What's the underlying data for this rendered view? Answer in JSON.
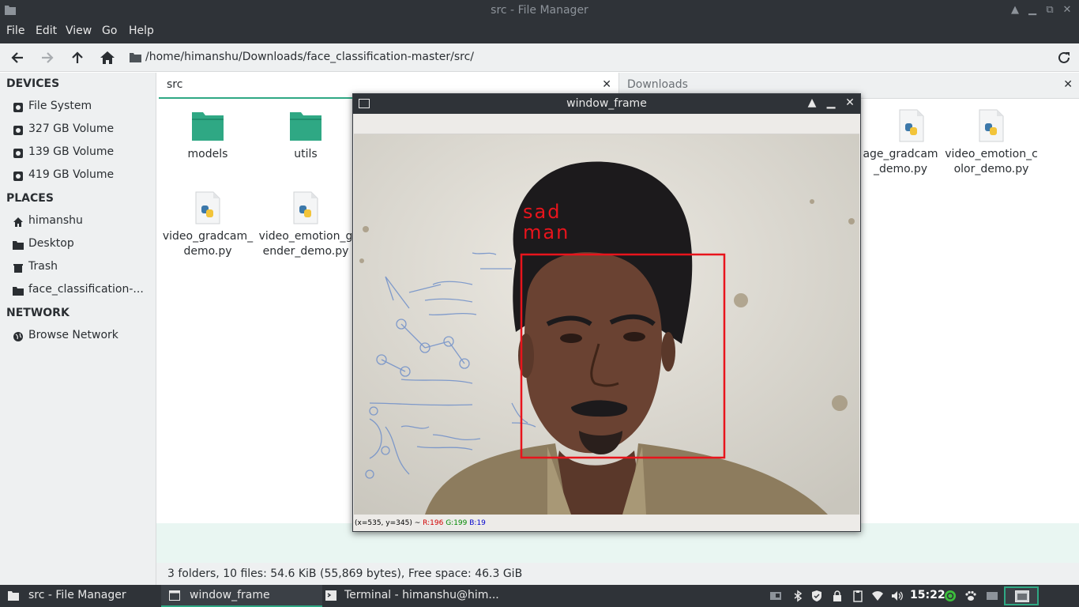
{
  "window": {
    "title": "src - File Manager"
  },
  "menu": [
    "File",
    "Edit",
    "Go",
    "Help"
  ],
  "toolbar": {
    "path": "/home/himanshu/Downloads/face_classification-master/src/"
  },
  "sidebar": {
    "devices_header": "DEVICES",
    "devices": [
      "File System",
      "327 GB Volume",
      "139 GB Volume",
      "419 GB Volume"
    ],
    "places_header": "PLACES",
    "places": [
      "himanshu",
      "Desktop",
      "Trash",
      "face_classification-..."
    ],
    "network_header": "NETWORK",
    "network": [
      "Browse Network"
    ]
  },
  "pane_left": {
    "tab": "src",
    "files": [
      {
        "name": "models",
        "type": "folder"
      },
      {
        "name": "utils",
        "type": "folder"
      },
      {
        "name": "video_gradcam_demo.py",
        "type": "python"
      },
      {
        "name": "video_emotion_gender_demo.py",
        "type": "python"
      }
    ]
  },
  "pane_right": {
    "tab": "Downloads",
    "files": [
      {
        "name": "image_gradcam_demo.py",
        "visible": "age_gradcam_demo.py",
        "type": "python"
      },
      {
        "name": "video_emotion_color_demo.py",
        "type": "python"
      }
    ]
  },
  "status": "3 folders, 10 files: 54.6 KiB (55,869 bytes), Free space: 46.3 GiB",
  "cv_window": {
    "title": "window_frame",
    "label_emotion": "sad",
    "label_gender": "man",
    "status_coords": "(x=535, y=345) ~",
    "status_r": "R:196",
    "status_g": "G:199",
    "status_b": "B:19"
  },
  "taskbar": {
    "tasks": [
      "src - File Manager",
      "window_frame",
      "Terminal - himanshu@him..."
    ],
    "clock": "15:22"
  },
  "colors": {
    "accent": "#2fa884",
    "dark": "#2f3338",
    "face_box": "#e8141c"
  }
}
